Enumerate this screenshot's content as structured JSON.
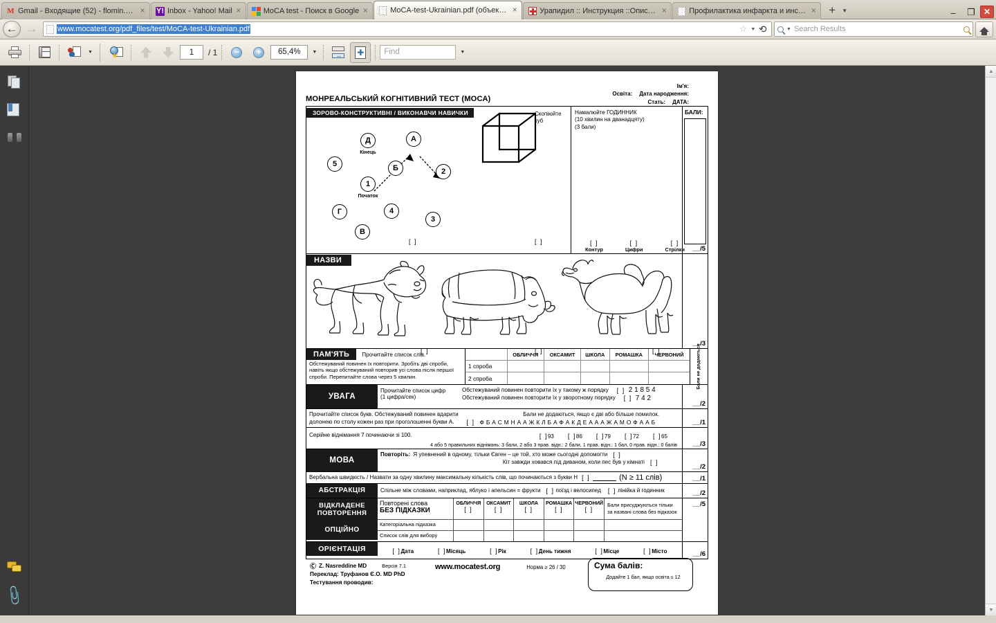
{
  "browser": {
    "tabs": [
      {
        "title": "Gmail - Входящие (52) - flomin.yur...",
        "favicon": "gmail-icon",
        "active": false
      },
      {
        "title": "Inbox - Yahoo! Mail",
        "favicon": "yahoo-icon",
        "active": false
      },
      {
        "title": "MoCA test - Поиск в Google",
        "favicon": "google-icon",
        "active": false
      },
      {
        "title": "MoCA-test-Ukrainian.pdf (объект ...",
        "favicon": "document-icon",
        "active": true
      },
      {
        "title": "Урапидил :: Инструкция ::Описа...",
        "favicon": "medical-icon",
        "active": false
      },
      {
        "title": "Профилактика инфаркта и инсул...",
        "favicon": "document-icon",
        "active": false
      }
    ],
    "new_tab_label": "+",
    "window_controls": {
      "minimize": "–",
      "restore": "❐",
      "close": "✕"
    },
    "url": "www.mocatest.org/pdf_files/test/MoCA-test-Ukrainian.pdf",
    "search_placeholder": "Search Results"
  },
  "pdf_toolbar": {
    "page_current": "1",
    "page_total": "/ 1",
    "zoom": "65,4%",
    "find_placeholder": "Find"
  },
  "form": {
    "title": "МОНРЕАЛЬСЬКИЙ КОГНІТИВНИЙ ТЕСТ (МОСА)",
    "identity": {
      "name": "Ім'я:",
      "education": "Освіта:",
      "sex": "Стать:",
      "birthdate": "Дата народження:",
      "date": "ДАТА:"
    },
    "visuospatial": {
      "band": "ЗОРОВО-КОНСТРУКТИВНІ / ВИКОНАВЧИ НАВИЧКИ",
      "score_header": "БАЛИ:",
      "trail_nodes": [
        "Д",
        "А",
        "5",
        "Б",
        "2",
        "1",
        "Г",
        "4",
        "3",
        "В"
      ],
      "label_end": "Кінець",
      "label_start": "Початок",
      "trail_bracket": "[    ]",
      "cube_caption": "Скопіюйте\nкуб",
      "cube_bracket": "[    ]",
      "clock_title": "Намалюйте ГОДИННИК",
      "clock_line2": "(10 хвилин на дванадцяту)",
      "clock_line3": "(3 бали)",
      "clock_items": [
        "Контур",
        "Цифри",
        "Стрілки"
      ],
      "clock_bracket": "[   ]",
      "score": "__/5"
    },
    "naming": {
      "band": "НАЗВИ",
      "animals": [
        "lion",
        "rhinoceros",
        "camel"
      ],
      "bracket": "[  ]",
      "score": "__/3"
    },
    "memory": {
      "band": "ПАМ'ЯТЬ",
      "instr_top": "Прочитайте список слів.",
      "instr_body": "Обстежуваний повинен їх повторити. Зробіть дві спроби, навіть якщо обстежуваний повторив усі слова після першої спроби.  Перепитайте слова через 5 хвилин.",
      "words": [
        "ОБЛИЧЧЯ",
        "ОКСАМИТ",
        "ШКОЛА",
        "РОМАШКА",
        "ЧЕРВОНИЙ"
      ],
      "trials": [
        "1 спроба",
        "2 спроба"
      ],
      "side_note": "Бали не додаються"
    },
    "attention": {
      "band": "УВАГА",
      "instr": "Прочитайте список цифр\n(1 цифра/сек)",
      "forward_label": "Обстежуваний повинен повторити їх у такому ж порядку",
      "forward_digits": "2  1  8  5  4",
      "backward_label": "Обстежуваний повинен повторити їх у зворотному порядку",
      "backward_digits": "7  4  2",
      "bracket": "[    ]",
      "score": "__/2"
    },
    "letters": {
      "line1": "Прочитайте список букв. Обстежуваний повинен вдарити",
      "line2": "долонею по столу кожен раз при проголошенні букви А.",
      "note": "Бали не додаються, якщо є дві або більше помилок.",
      "sequence": "Ф Б А С М Н А А Ж К Л Б А Ф А К Д Е А А А Ж А М О Ф А А Б",
      "bracket": "[    ]",
      "score": "__/1"
    },
    "serial7": {
      "instr": "Серійне віднімання 7 починаючи зі 100.",
      "answers": [
        "93",
        "86",
        "79",
        "72",
        "65"
      ],
      "bracket": "[    ]",
      "note": "4 або 5 правильних віднімань: 3 бали,  2 або 3 прав. відн.: 2 бали,  1 прав. відн.: 1 бал,  0 прав. відн.: 0 балів",
      "score": "__/3"
    },
    "language": {
      "band": "МОВА",
      "repeat_label": "Повторіть:",
      "sentence1": "Я упевнений в одному, тільки Євген – це той, хто може сьогодні допомогти",
      "sentence2": "Кіт завжди ховався під диваном, коли пес був у кімнаті",
      "bracket": "[   ]",
      "score": "__/2"
    },
    "fluency": {
      "text": "Вербальна швидкість / Назвати за одну хвилину максимальну кількість слів, що починаються з букви Н",
      "bracket": "[    ]",
      "criterion": "(N ≥ 11 слів)",
      "score": "__/1"
    },
    "abstraction": {
      "band": "АБСТРАКЦІЯ",
      "text": "Спільне між словами, наприклад, яблуко і апельсин = фрукти",
      "item1": "поїзд і велосипед",
      "item2": "лінійка й годинник",
      "bracket": "[   ]",
      "score": "__/2"
    },
    "delayed_recall": {
      "band_line1": "ВІДКЛАДЕНЕ",
      "band_line2": "ПОВТОРЕННЯ",
      "optional_band": "ОПЦІЙНО",
      "recall_label_1": "Повторені слова",
      "recall_label_2": "БЕЗ ПІДКАЗКИ",
      "words": [
        "ОБЛИЧЧЯ",
        "ОКСАМИТ",
        "ШКОЛА",
        "РОМАШКА",
        "ЧЕРВОНИЙ"
      ],
      "bracket": "[   ]",
      "cue_category": "Категоріальна підказка",
      "cue_multiple": "Список слів для вибору",
      "note": "Бали присуджуються тільки за названі слова без підказок",
      "score": "__/5"
    },
    "orientation": {
      "band": "ОРІЄНТАЦІЯ",
      "items": [
        "Дата",
        "Місяць",
        "Рік",
        "День тижня",
        "Місце",
        "Місто"
      ],
      "bracket": "[    ]",
      "score": "__/6"
    },
    "footer": {
      "copyright": "Z. Nasreddine MD",
      "version": "Версія 7.1",
      "translation": "Переклад: Труфанов Є.О. MD PhD",
      "tester": "Тестування проводив:",
      "website": "www.mocatest.org",
      "norm": "Норма ≥ 26 / 30",
      "total_label": "Сума балів:",
      "total_note": "Додайте 1 бал, якщо освіта ≤ 12"
    }
  }
}
